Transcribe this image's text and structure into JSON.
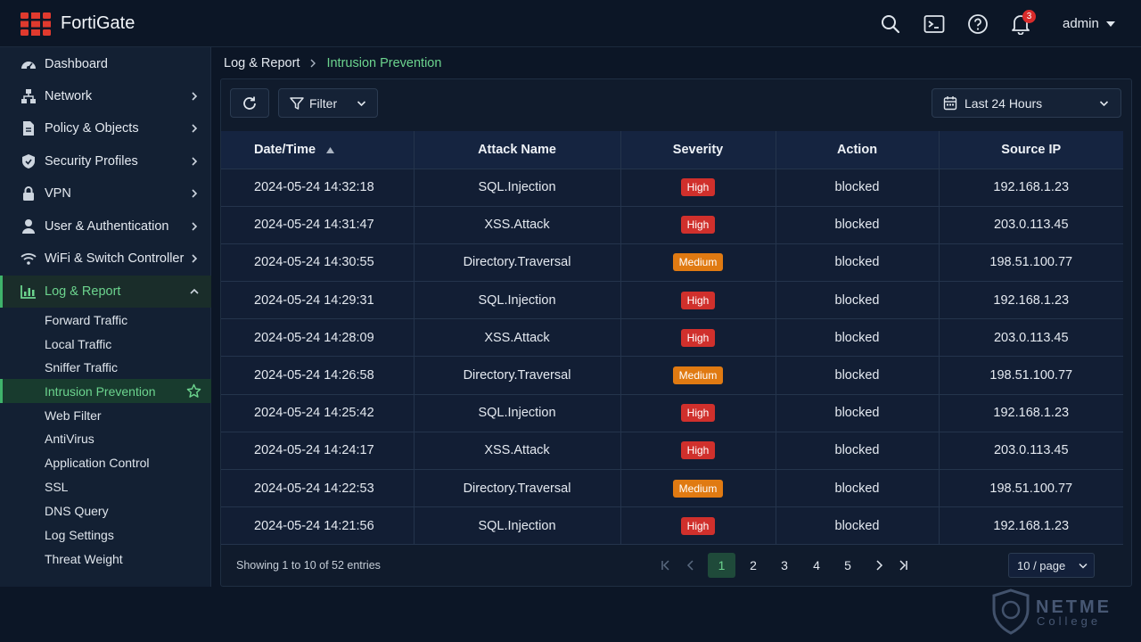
{
  "app": {
    "brand": "FortiGate"
  },
  "header": {
    "notification_count": "3",
    "user": "admin",
    "icons": [
      "search-icon",
      "terminal-icon",
      "help-icon",
      "bell-icon"
    ]
  },
  "sidebar": {
    "items": [
      {
        "label": "Dashboard",
        "icon": "dashboard-icon"
      },
      {
        "label": "Network",
        "icon": "network-icon"
      },
      {
        "label": "Policy & Objects",
        "icon": "document-icon"
      },
      {
        "label": "Security Profiles",
        "icon": "shield-icon"
      },
      {
        "label": "VPN",
        "icon": "lock-icon"
      },
      {
        "label": "User & Authentication",
        "icon": "user-icon"
      },
      {
        "label": "WiFi & Switch Controller",
        "icon": "wifi-icon"
      },
      {
        "label": "Log & Report",
        "icon": "chart-icon"
      }
    ],
    "log_subitems": [
      "Forward Traffic",
      "Local Traffic",
      "Sniffer Traffic",
      "Intrusion Prevention",
      "Web Filter",
      "AntiVirus",
      "Application Control",
      "SSL",
      "DNS Query",
      "Log Settings",
      "Threat Weight"
    ]
  },
  "breadcrumb": {
    "parent": "Log & Report",
    "current": "Intrusion Prevention"
  },
  "toolbar": {
    "filter_label": "Filter",
    "time_range": "Last 24 Hours"
  },
  "table": {
    "columns": [
      "Date/Time",
      "Attack Name",
      "Severity",
      "Action",
      "Source IP"
    ],
    "rows": [
      [
        "2024-05-24 14:32:18",
        "SQL.Injection",
        "High",
        "blocked",
        "192.168.1.23"
      ],
      [
        "2024-05-24 14:31:47",
        "XSS.Attack",
        "High",
        "blocked",
        "203.0.113.45"
      ],
      [
        "2024-05-24 14:30:55",
        "Directory.Traversal",
        "Medium",
        "blocked",
        "198.51.100.77"
      ],
      [
        "2024-05-24 14:29:31",
        "SQL.Injection",
        "High",
        "blocked",
        "192.168.1.23"
      ],
      [
        "2024-05-24 14:28:09",
        "XSS.Attack",
        "High",
        "blocked",
        "203.0.113.45"
      ],
      [
        "2024-05-24 14:26:58",
        "Directory.Traversal",
        "Medium",
        "blocked",
        "198.51.100.77"
      ],
      [
        "2024-05-24 14:25:42",
        "SQL.Injection",
        "High",
        "blocked",
        "192.168.1.23"
      ],
      [
        "2024-05-24 14:24:17",
        "XSS.Attack",
        "High",
        "blocked",
        "203.0.113.45"
      ],
      [
        "2024-05-24 14:22:53",
        "Directory.Traversal",
        "Medium",
        "blocked",
        "198.51.100.77"
      ],
      [
        "2024-05-24 14:21:56",
        "SQL.Injection",
        "High",
        "blocked",
        "192.168.1.23"
      ]
    ]
  },
  "footer": {
    "showing": "Showing 1 to 10 of 52 entries",
    "pages": [
      "1",
      "2",
      "3",
      "4",
      "5"
    ],
    "current_page": "1",
    "page_size": "10 / page"
  },
  "watermark": {
    "line1": "NETME",
    "line2": "College"
  },
  "colors": {
    "accent": "#6cd48e",
    "high": "#d0302c",
    "medium": "#e07a12",
    "brand_red": "#e03a2e"
  }
}
